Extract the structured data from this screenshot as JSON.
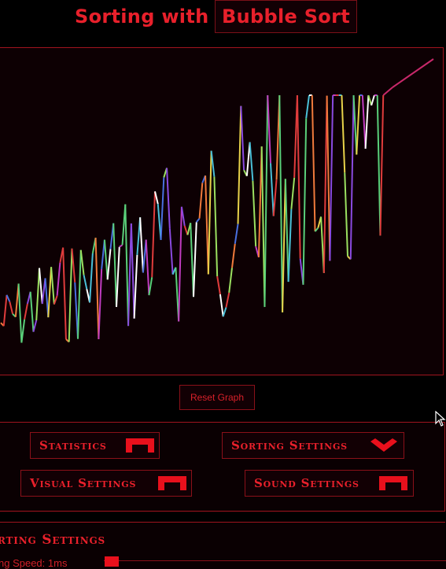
{
  "header": {
    "title_prefix": "Sorting with",
    "algorithm": "Bubble Sort"
  },
  "graph": {
    "reset_label": "Reset Graph",
    "colors": [
      "#e03c3c",
      "#f07a3c",
      "#e8d24a",
      "#9be060",
      "#5ad07a",
      "#4ac0d8",
      "#4a70e0",
      "#8a4ae0",
      "#c03cc0",
      "#ffffff"
    ]
  },
  "panel": {
    "statistics_label": "Statistics",
    "sorting_settings_label": "Sorting Settings",
    "visual_settings_label": "Visual Settings",
    "sound_settings_label": "Sound Settings"
  },
  "sorting_section": {
    "title": "rting Settings",
    "speed_label": "ng Speed: 1ms"
  },
  "accent_color": "#e8202b"
}
